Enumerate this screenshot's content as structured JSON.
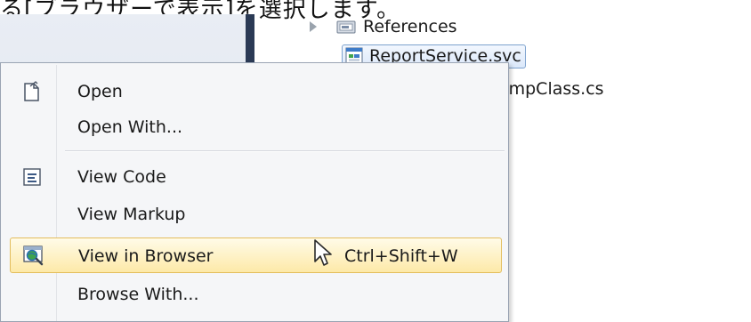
{
  "caption": "る[ブラウザーで表示]を選択します。",
  "tree": {
    "references": "References",
    "selected_file": "ReportService.svc",
    "partial_file": "ImpClass.cs"
  },
  "menu": {
    "open": "Open",
    "open_with": "Open With...",
    "view_code": "View Code",
    "view_markup": "View Markup",
    "view_in_browser": "View in Browser",
    "view_in_browser_shortcut": "Ctrl+Shift+W",
    "browse_with": "Browse With..."
  },
  "icons": {
    "expand": "expand-arrow-icon",
    "references": "references-folder-icon",
    "svc": "svc-file-icon",
    "open": "document-icon",
    "view_code": "code-view-icon",
    "browser": "browser-globe-icon",
    "cursor": "mouse-pointer-icon"
  },
  "colors": {
    "highlight_border": "#e3bd5c",
    "highlight_fill": "#fde9a8",
    "selection_border": "#7da2ce",
    "splitter": "#2b3a55"
  }
}
